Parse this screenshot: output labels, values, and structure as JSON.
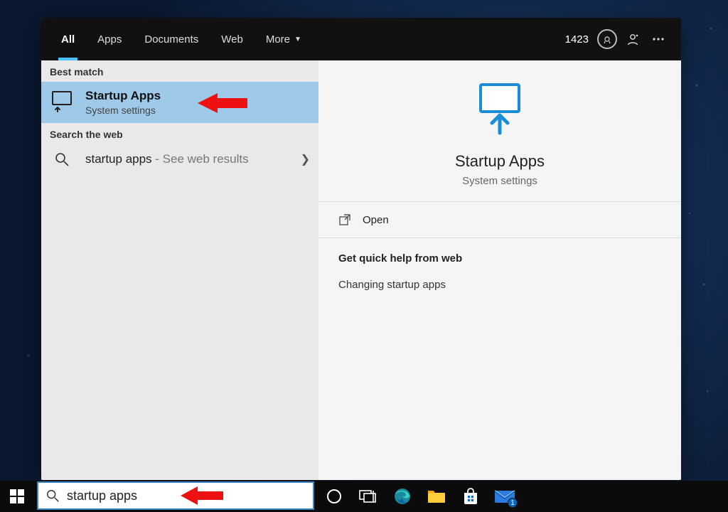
{
  "tabs": {
    "all": "All",
    "apps": "Apps",
    "documents": "Documents",
    "web": "Web",
    "more": "More"
  },
  "rewards_points": "1423",
  "sections": {
    "best_match": "Best match",
    "search_web": "Search the web"
  },
  "best_match": {
    "title": "Startup Apps",
    "subtitle": "System settings"
  },
  "web_result": {
    "query_text": "startup apps",
    "suffix": " - See web results"
  },
  "details": {
    "title": "Startup Apps",
    "subtitle": "System settings",
    "open_label": "Open",
    "help_header": "Get quick help from web",
    "help_link_1": "Changing startup apps"
  },
  "search_value": "startup apps",
  "mail_badge": "1",
  "colors": {
    "accent": "#0078d4",
    "selection": "#9fc9e8",
    "annotation": "#e11"
  }
}
